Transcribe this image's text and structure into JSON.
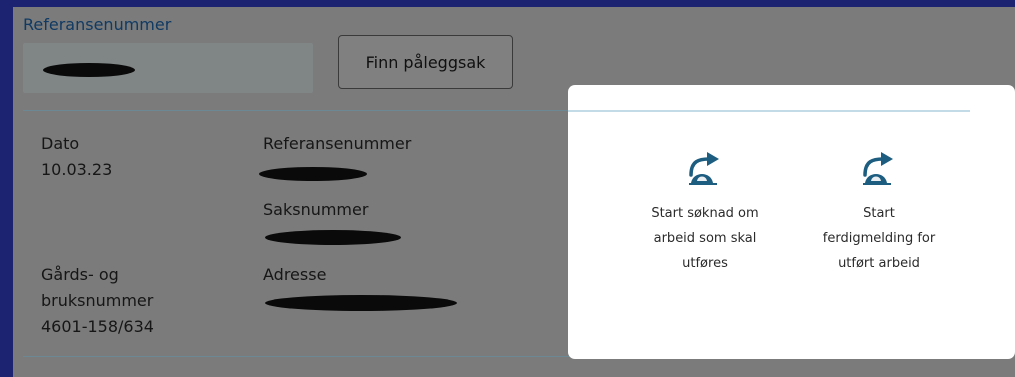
{
  "search": {
    "label": "Referansenummer",
    "button_label": "Finn påleggsak"
  },
  "case": {
    "date_label": "Dato",
    "date_value": "10.03.23",
    "ref_label": "Referansenummer",
    "case_number_label": "Saksnummer",
    "property_label_line1": "Gårds- og",
    "property_label_line2": "bruksnummer",
    "property_value": "4601-158/634",
    "address_label": "Adresse"
  },
  "actions": [
    {
      "label_lines": [
        "Start søknad om",
        "arbeid som skal",
        "utføres"
      ],
      "icon": "arrow-forward-icon"
    },
    {
      "label_lines": [
        "Start",
        "ferdigmelding for",
        "utført arbeid"
      ],
      "icon": "arrow-forward-icon"
    }
  ],
  "colors": {
    "frame": "#1c2371",
    "overlay_panel": "#7b7b7b",
    "card": "#ffffff",
    "icon": "#1d5d80",
    "label_blue": "#103a63"
  }
}
